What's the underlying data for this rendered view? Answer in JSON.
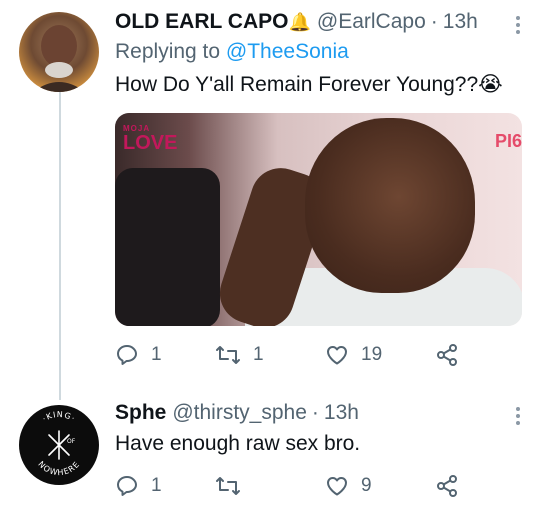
{
  "tweets": [
    {
      "name": "OLD EARL CAPO",
      "name_emoji": "🔔",
      "handle": "@EarlCapo",
      "separator": "·",
      "time": "13h",
      "replying_prefix": "Replying to",
      "replying_to": "@TheeSonia",
      "text": "How Do Y'all Remain Forever Young??",
      "text_emoji": "😭",
      "media": {
        "logo_small": "MOJA",
        "logo_big": "LOVE",
        "corner_text": "PI6"
      },
      "replies": "1",
      "retweets": "1",
      "likes": "19"
    },
    {
      "name": "Sphe",
      "handle": "@thirsty_sphe",
      "separator": "·",
      "time": "13h",
      "text": "Have enough raw sex bro.",
      "replies": "1",
      "retweets": "",
      "likes": "9",
      "avatar_text": {
        "top": "·KING·",
        "mid": "OF",
        "bottom": "NOWHERE"
      }
    }
  ],
  "icons": [
    "reply-icon",
    "retweet-icon",
    "like-icon",
    "share-icon",
    "more-icon"
  ],
  "colors": {
    "text": "#0f1419",
    "secondary": "#536471",
    "link": "#1d9bf0",
    "thread_line": "#cfd9de"
  }
}
